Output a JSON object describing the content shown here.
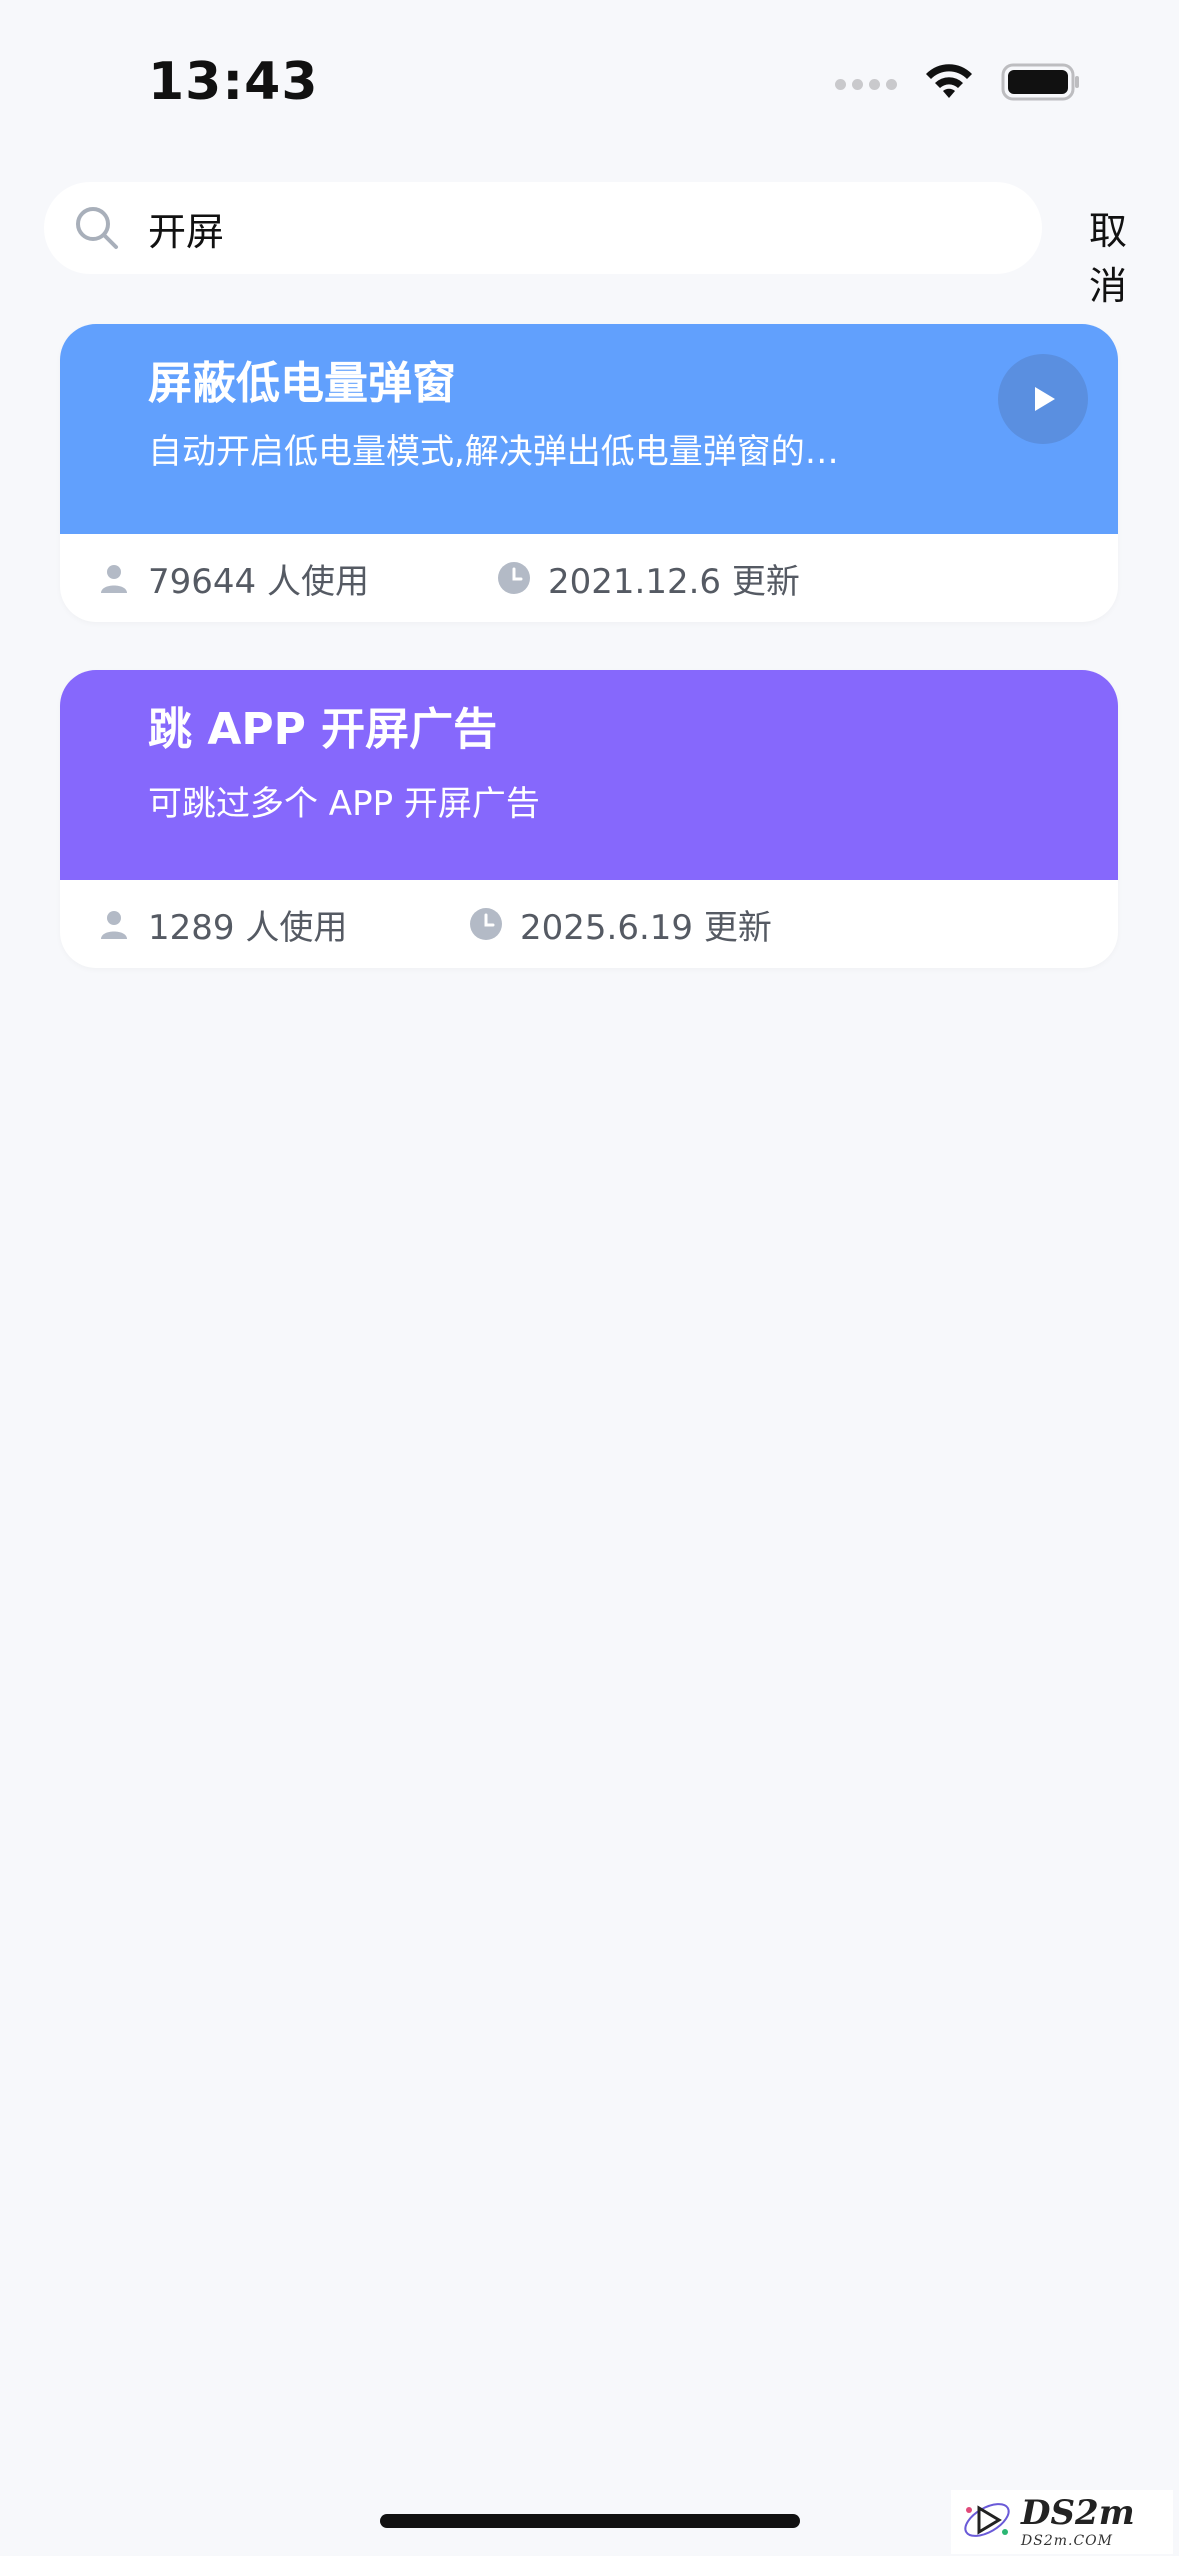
{
  "status_bar": {
    "time": "13:43",
    "icons": [
      "signal-dots-icon",
      "wifi-icon",
      "battery-icon"
    ]
  },
  "search": {
    "value": "开屏",
    "placeholder": "",
    "cancel_label": "取消",
    "icon": "search-icon"
  },
  "results": [
    {
      "title": "屏蔽低电量弹窗",
      "description": "自动开启低电量模式,解决弹出低电量弹窗的…",
      "users": "79644 人使用",
      "updated": "2021.12.6 更新",
      "color": "#61a0fd",
      "has_play_button": true
    },
    {
      "title": "跳 APP 开屏广告",
      "description": "可跳过多个 APP 开屏广告",
      "users": "1289 人使用",
      "updated": "2025.6.19 更新",
      "color": "#8668fc",
      "has_play_button": false
    }
  ],
  "watermark": {
    "main": "DS2m",
    "sub": "DS2m.COM"
  }
}
